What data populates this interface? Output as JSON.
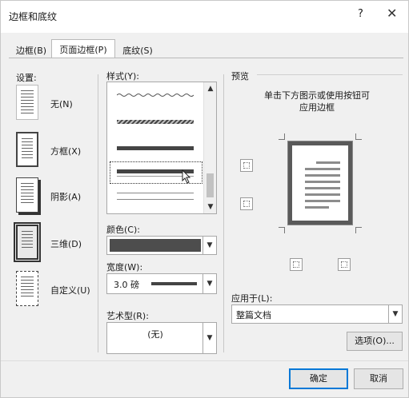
{
  "window": {
    "title": "边框和底纹",
    "help_icon": "?",
    "close_icon": "✕"
  },
  "tabs": [
    {
      "label": "边框(B)",
      "active": false
    },
    {
      "label": "页面边框(P)",
      "active": true
    },
    {
      "label": "底纹(S)",
      "active": false
    }
  ],
  "settings": {
    "label": "设置:",
    "items": [
      {
        "label": "无(N)",
        "icon": "none-border-icon"
      },
      {
        "label": "方框(X)",
        "icon": "box-border-icon"
      },
      {
        "label": "阴影(A)",
        "icon": "shadow-border-icon"
      },
      {
        "label": "三维(D)",
        "icon": "3d-border-icon",
        "selected": true
      },
      {
        "label": "自定义(U)",
        "icon": "custom-border-icon"
      }
    ]
  },
  "style": {
    "label": "样式(Y):",
    "selected_index": 3
  },
  "color": {
    "label": "颜色(C):",
    "value": "#4d4d4d"
  },
  "width": {
    "label": "宽度(W):",
    "value": "3.0 磅"
  },
  "art": {
    "label": "艺术型(R):",
    "value": "(无)"
  },
  "preview": {
    "label": "预览",
    "hint_line1": "单击下方图示或使用按钮可",
    "hint_line2": "应用边框"
  },
  "apply_to": {
    "label": "应用于(L):",
    "value": "整篇文档"
  },
  "buttons": {
    "options": "选项(O)...",
    "ok": "确定",
    "cancel": "取消"
  }
}
